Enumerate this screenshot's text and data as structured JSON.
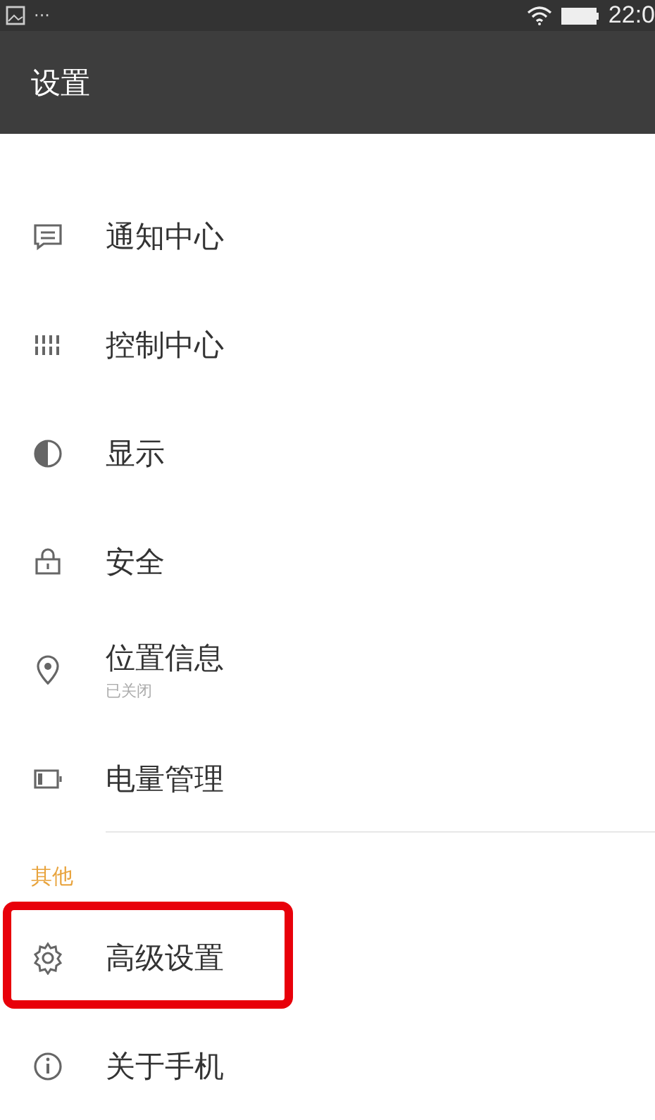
{
  "status_bar": {
    "notification_more": "···",
    "time": "22:0"
  },
  "app_bar": {
    "title": "设置"
  },
  "sections": [
    {
      "items": [
        {
          "kind": "message",
          "label": "通知中心",
          "highlighted": false
        },
        {
          "kind": "sliders",
          "label": "控制中心",
          "highlighted": false
        },
        {
          "kind": "contrast",
          "label": "显示",
          "highlighted": false
        },
        {
          "kind": "lock",
          "label": "安全",
          "highlighted": false
        },
        {
          "kind": "pin",
          "label": "位置信息",
          "subtitle": "已关闭",
          "highlighted": false
        },
        {
          "kind": "battery",
          "label": "电量管理",
          "highlighted": false
        }
      ]
    },
    {
      "header": "其他",
      "items": [
        {
          "kind": "gear",
          "label": "高级设置",
          "highlighted": true
        },
        {
          "kind": "info",
          "label": "关于手机",
          "highlighted": false
        }
      ]
    }
  ]
}
